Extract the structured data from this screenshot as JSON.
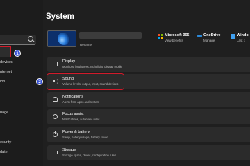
{
  "sidebar": {
    "search_placeholder": "",
    "items": [
      {
        "label": "devices"
      },
      {
        "label": "nternet"
      },
      {
        "label": "ion"
      },
      {
        "label": "uage"
      },
      {
        "label": "ecurity"
      },
      {
        "label": "date"
      }
    ],
    "badge_1": "1"
  },
  "header": {
    "title": "System",
    "rename": "Rename",
    "apps": [
      {
        "title": "Microsoft 365",
        "subtitle": "View benefits",
        "icon": "microsoft-icon"
      },
      {
        "title": "OneDrive",
        "subtitle": "Manage",
        "icon": "onedrive-icon"
      },
      {
        "title": "Windo",
        "subtitle": "Last c",
        "icon": "windows-update-icon"
      }
    ]
  },
  "cards": [
    {
      "title": "Display",
      "desc": "Monitors, brightness, night light, display profile",
      "icon": "display-icon"
    },
    {
      "title": "Sound",
      "desc": "Volume levels, output, input, sound devices",
      "icon": "sound-icon"
    },
    {
      "title": "Notifications",
      "desc": "Alerts from apps and system",
      "icon": "bell-icon"
    },
    {
      "title": "Focus assist",
      "desc": "Notifications, automatic rules",
      "icon": "moon-icon"
    },
    {
      "title": "Power & battery",
      "desc": "Sleep, battery usage, battery saver",
      "icon": "power-icon"
    },
    {
      "title": "Storage",
      "desc": "Storage space, drives, configuration rules",
      "icon": "storage-icon"
    }
  ],
  "badge_2": "2",
  "colors": {
    "highlight": "#d11a2a",
    "badge": "#3b55d6",
    "background": "#1f1f1f",
    "card": "#2b2b2b"
  }
}
